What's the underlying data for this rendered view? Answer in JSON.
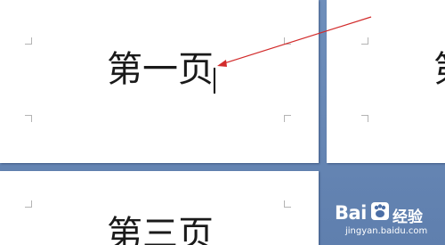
{
  "pages": [
    {
      "text": "第一页",
      "has_cursor": true
    },
    {
      "text": "第",
      "partially_visible": true
    },
    {
      "text": "第三页",
      "partially_visible": true
    }
  ],
  "annotation": {
    "type": "arrow",
    "color": "#d22b2b",
    "points_to": "text-cursor"
  },
  "watermark": {
    "logo": "Bai",
    "product": "经验",
    "url": "jingyan.baidu.com"
  },
  "colors": {
    "workspace": "#6f8fbb",
    "page": "#ffffff",
    "margin_mark": "#b3b3b3"
  }
}
